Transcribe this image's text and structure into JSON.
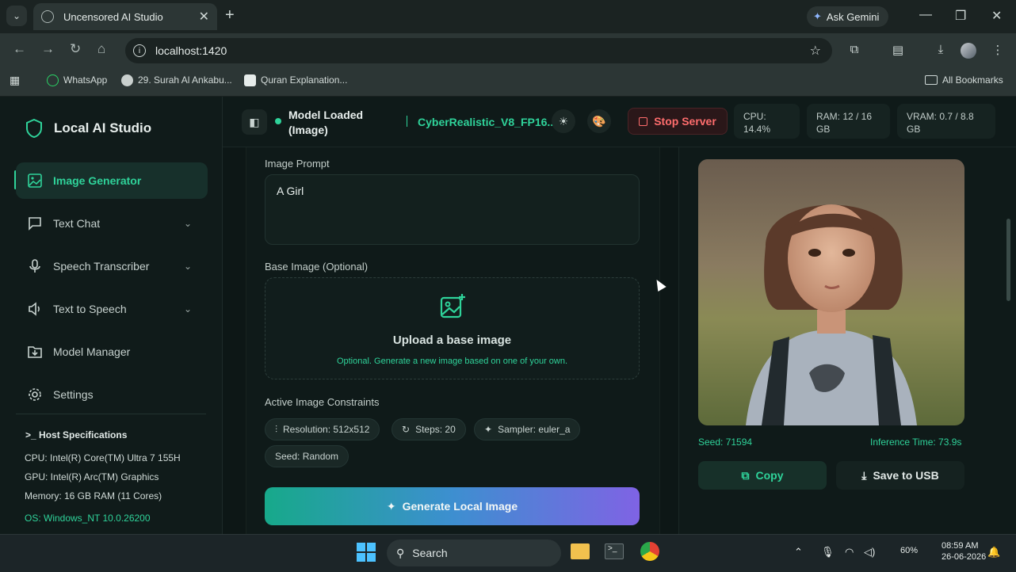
{
  "browser": {
    "tab_title": "Uncensored AI Studio",
    "ask_gemini": "Ask Gemini",
    "url": "localhost:1420",
    "bookmarks": [
      {
        "label": "WhatsApp"
      },
      {
        "label": "29. Surah Al Ankabu..."
      },
      {
        "label": "Quran Explanation..."
      }
    ],
    "all_bookmarks": "All Bookmarks"
  },
  "sidebar": {
    "app_title": "Local AI Studio",
    "items": [
      {
        "label": "Image Generator",
        "icon": "image-icon",
        "active": true
      },
      {
        "label": "Text Chat",
        "icon": "chat-icon"
      },
      {
        "label": "Speech Transcriber",
        "icon": "mic-icon"
      },
      {
        "label": "Text to Speech",
        "icon": "speaker-icon"
      },
      {
        "label": "Model Manager",
        "icon": "folder-download-icon"
      },
      {
        "label": "Settings",
        "icon": "gear-icon"
      }
    ],
    "host_title": "Host Specifications",
    "specs": [
      "CPU: Intel(R) Core(TM) Ultra 7 155H",
      "GPU: Intel(R) Arc(TM) Graphics",
      "Memory: 16 GB RAM (11 Cores)",
      "OS: Windows_NT 10.0.26200"
    ]
  },
  "header": {
    "status": "Model Loaded (Image)",
    "model_name": "CyberRealistic_V8_FP16...",
    "stop_server": "Stop Server",
    "cpu": "CPU: 14.4%",
    "ram": "RAM: 12 / 16 GB",
    "vram": "VRAM: 0.7 / 8.8 GB"
  },
  "form": {
    "prompt_label": "Image Prompt",
    "prompt_value": "A Girl",
    "base_label": "Base Image (Optional)",
    "upload_title": "Upload a base image",
    "upload_hint": "Optional. Generate a new image based on one of your own.",
    "constraints_label": "Active Image Constraints",
    "chips": [
      "Resolution: 512x512",
      "Steps: 20",
      "Sampler: euler_a",
      "Seed: Random"
    ],
    "generate": "Generate Local Image"
  },
  "result": {
    "seed": "Seed: 71594",
    "inference": "Inference Time: 73.9s",
    "copy": "Copy",
    "save": "Save to USB"
  },
  "taskbar": {
    "search": "Search",
    "battery": "60%",
    "time": "08:59 AM",
    "date": "26-06-2026"
  },
  "colors": {
    "accent": "#2fd39a",
    "danger": "#ff6d6d",
    "bg": "#0f1a19"
  }
}
